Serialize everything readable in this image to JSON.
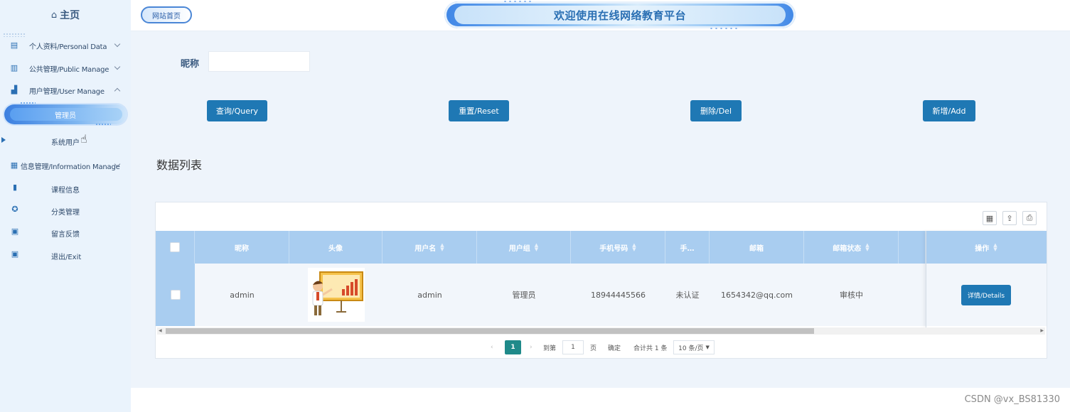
{
  "sidebar": {
    "home": "主页",
    "items": [
      {
        "label": "个人资料/Personal Data",
        "icon": "document-icon"
      },
      {
        "label": "公共管理/Public Manage",
        "icon": "clipboard-icon"
      },
      {
        "label": "用户管理/User Manage",
        "icon": "users-icon"
      },
      {
        "label": "信息管理/Information Manage",
        "icon": "chart-icon"
      }
    ],
    "sub_user": {
      "active": "管理员",
      "second": "系统用户"
    },
    "sub_info": [
      {
        "label": "课程信息",
        "icon": "bookmark-icon"
      },
      {
        "label": "分类管理",
        "icon": "badge-icon"
      },
      {
        "label": "留言反馈",
        "icon": "calendar-icon"
      },
      {
        "label": "退出/Exit",
        "icon": "calendar-check-icon"
      }
    ]
  },
  "header": {
    "home_badge": "网站首页",
    "banner_title": "欢迎使用在线网络教育平台"
  },
  "search": {
    "label": "昵称",
    "value": ""
  },
  "actions": {
    "query": "查询/Query",
    "reset": "重置/Reset",
    "delete": "删除/Del",
    "add": "新增/Add"
  },
  "list_title": "数据列表",
  "table": {
    "columns": [
      "昵称",
      "头像",
      "用户名",
      "用户组",
      "手机号码",
      "手…",
      "邮箱",
      "邮箱状态",
      "",
      "操作"
    ],
    "rows": [
      {
        "nickname": "admin",
        "username": "admin",
        "group": "管理员",
        "phone": "18944445566",
        "phone_status": "未认证",
        "email": "1654342@qq.com",
        "email_status": "审核中",
        "details_label": "详情/Details"
      }
    ]
  },
  "pagination": {
    "current_page": "1",
    "goto_label": "到第",
    "goto_value": "1",
    "page_unit": "页",
    "confirm": "确定",
    "total": "合计共 1 条",
    "page_size": "10 条/页"
  },
  "watermark": "CSDN @vx_BS81330",
  "colors": {
    "primary_button": "#1f78b4",
    "table_header": "#a9cdf0",
    "sidebar_bg": "#eaf3fc",
    "main_bg": "#eef4fb",
    "pager_current": "#1f8a8a"
  }
}
